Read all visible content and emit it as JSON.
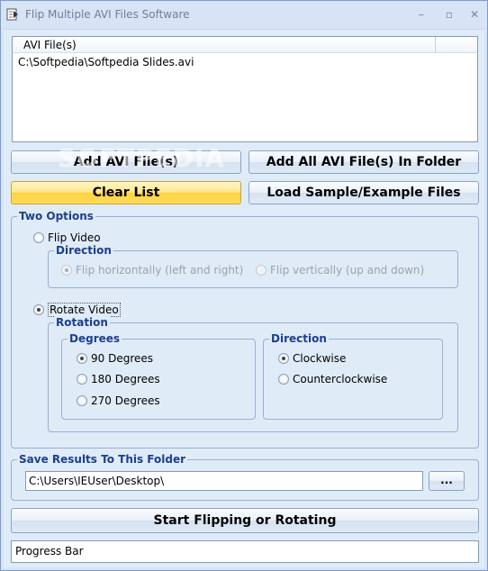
{
  "window": {
    "title": "Flip Multiple AVI Files Software",
    "minimize": "–",
    "maximize": "▫",
    "close": "✕"
  },
  "file_list": {
    "column_header": "AVI File(s)",
    "rows": [
      "C:\\Softpedia\\Softpedia Slides.avi"
    ]
  },
  "watermark": "SOFTPEDIA",
  "buttons": {
    "add_files": "Add AVI File(s)",
    "add_folder": "Add All AVI File(s) In Folder",
    "clear_list": "Clear List",
    "load_sample": "Load Sample/Example Files",
    "browse": "...",
    "start": "Start Flipping or Rotating"
  },
  "options": {
    "group_title": "Two Options",
    "flip_label": "Flip Video",
    "flip_direction_title": "Direction",
    "flip_horizontal": "Flip horizontally (left and right)",
    "flip_vertical": "Flip vertically (up and down)",
    "rotate_label": "Rotate Video",
    "rotation_title": "Rotation",
    "degrees_title": "Degrees",
    "deg_90": "90 Degrees",
    "deg_180": "180 Degrees",
    "deg_270": "270 Degrees",
    "rot_direction_title": "Direction",
    "clockwise": "Clockwise",
    "counterclockwise": "Counterclockwise"
  },
  "save": {
    "group_title": "Save Results To This Folder",
    "folder_value": "C:\\Users\\IEUser\\Desktop\\"
  },
  "progress": {
    "label": "Progress Bar"
  },
  "colors": {
    "accent": "#1b3f8c",
    "clear_button": "#ffd23d"
  }
}
